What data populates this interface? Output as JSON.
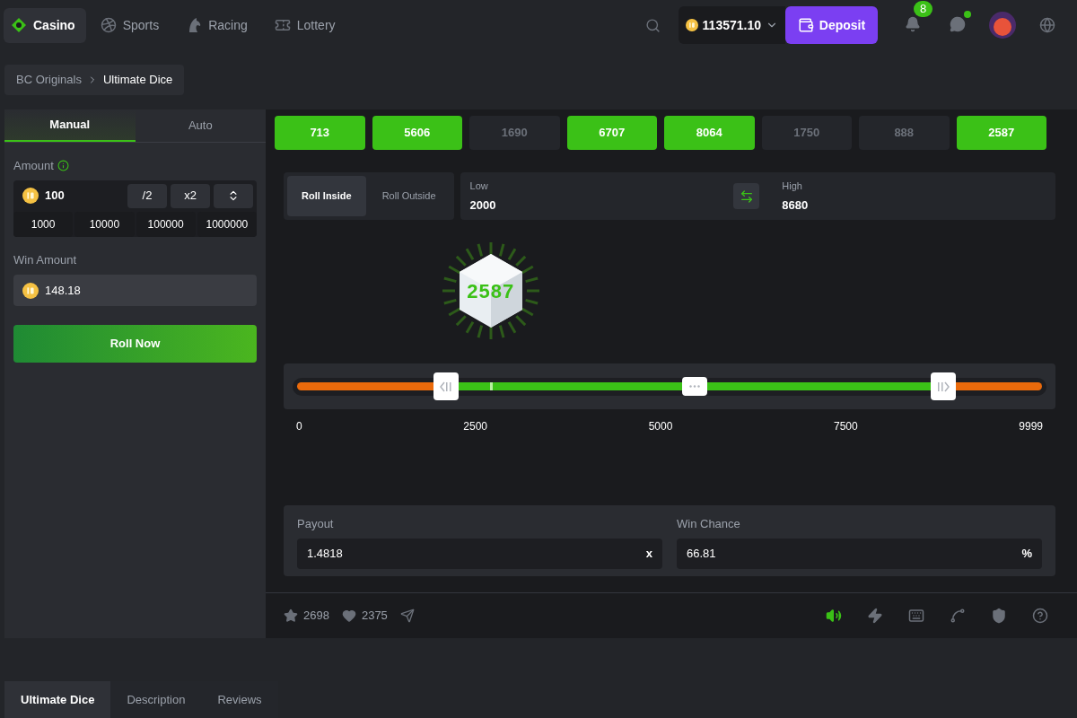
{
  "nav": {
    "items": [
      {
        "label": "Casino",
        "selected": true
      },
      {
        "label": "Sports",
        "selected": false
      },
      {
        "label": "Racing",
        "selected": false
      },
      {
        "label": "Lottery",
        "selected": false
      }
    ]
  },
  "header": {
    "balance": "113571.10",
    "deposit": "Deposit",
    "notifications": "8",
    "chat_online": true
  },
  "breadcrumb": [
    "BC Originals",
    "Ultimate Dice"
  ],
  "bet_panel": {
    "tabs": [
      {
        "label": "Manual",
        "selected": true
      },
      {
        "label": "Auto",
        "selected": false
      }
    ],
    "amount_label": "Amount",
    "amount": "100",
    "half": "/2",
    "double": "x2",
    "presets": [
      "1000",
      "10000",
      "100000",
      "1000000"
    ],
    "win_label": "Win Amount",
    "win_amount": "148.18",
    "roll_button": "Roll Now"
  },
  "history": [
    {
      "value": "713",
      "win": true
    },
    {
      "value": "5606",
      "win": true
    },
    {
      "value": "1690",
      "win": false
    },
    {
      "value": "6707",
      "win": true
    },
    {
      "value": "8064",
      "win": true
    },
    {
      "value": "1750",
      "win": false
    },
    {
      "value": "888",
      "win": false
    },
    {
      "value": "2587",
      "win": true
    }
  ],
  "mode": [
    {
      "label": "Roll Inside",
      "selected": true
    },
    {
      "label": "Roll Outside",
      "selected": false
    }
  ],
  "range": {
    "low_label": "Low",
    "low": "2000",
    "high_label": "High",
    "high": "8680"
  },
  "result": {
    "value": "2587",
    "marker": {
      "level": 0.2587
    }
  },
  "slider": {
    "handles": [
      {
        "level": 0.2
      },
      {
        "level": 0.868
      }
    ],
    "ticks": [
      "0",
      "2500",
      "5000",
      "7500",
      "9999"
    ]
  },
  "payout": {
    "label": "Payout",
    "value": "1.4818",
    "suffix": "x"
  },
  "win_chance": {
    "label": "Win Chance",
    "value": "66.81",
    "suffix": "%"
  },
  "footer": {
    "stars": "2698",
    "likes": "2375",
    "sound_on": true
  },
  "bottom_tabs": [
    {
      "label": "Ultimate Dice",
      "selected": true
    },
    {
      "label": "Description",
      "selected": false
    },
    {
      "label": "Reviews",
      "selected": false
    }
  ]
}
